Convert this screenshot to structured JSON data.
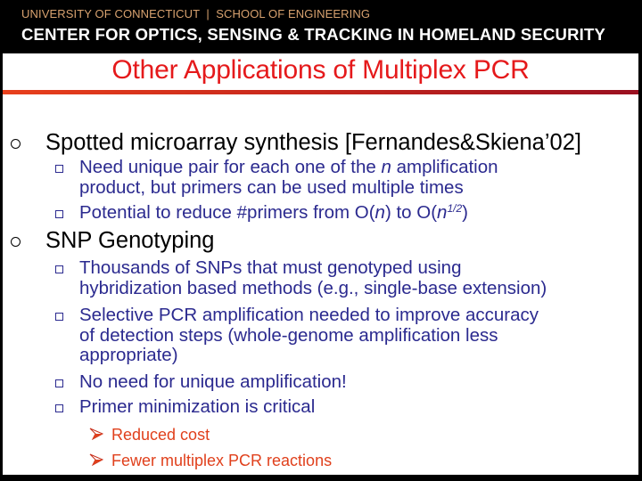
{
  "header": {
    "institution": "UNIVERSITY OF CONNECTICUT  |  SCHOOL OF ENGINEERING",
    "center": "CENTER FOR OPTICS, SENSING & TRACKING IN HOMELAND SECURITY"
  },
  "slide": {
    "title": "Other Applications of Multiplex PCR",
    "colors": {
      "title": "#e5191b",
      "level1_text": "#000000",
      "level2_text": "#2b2a8f",
      "level3_text": "#e0401c",
      "header_top": "#d8a26f"
    },
    "items": [
      {
        "text": "Spotted microarray synthesis [Fernandes&Skiena’02]",
        "bullet_icon": "hollow-circle-bullet",
        "subitems": [
          {
            "lines": [
              {
                "before": "Need unique pair for each one of the ",
                "italic": "n",
                "after": " amplification"
              },
              {
                "before": "product, but primers can be used multiple times"
              }
            ]
          },
          {
            "lines": [
              {
                "before": "Potential to reduce #primers from O(",
                "italic": "n",
                "after": ") to O(",
                "italic2": "n",
                "sup": "1/2",
                "after2": ")"
              }
            ]
          }
        ]
      },
      {
        "text": "SNP Genotyping",
        "bullet_icon": "hollow-circle-bullet",
        "subitems": [
          {
            "lines": [
              {
                "before": "Thousands of SNPs that must genotyped using"
              },
              {
                "before": "hybridization based methods (e.g., single-base extension)"
              }
            ]
          },
          {
            "lines": [
              {
                "before": "Selective PCR amplification needed to improve accuracy"
              },
              {
                "before": "of detection steps (whole-genome amplification less"
              },
              {
                "before": "appropriate)"
              }
            ]
          },
          {
            "lines": [
              {
                "before": "No need for unique amplification!"
              }
            ]
          },
          {
            "lines": [
              {
                "before": "Primer minimization is critical"
              }
            ],
            "subitems": [
              {
                "text": "Reduced cost",
                "bullet_icon": "arrowhead-bullet"
              },
              {
                "text": "Fewer multiplex PCR reactions",
                "bullet_icon": "arrowhead-bullet"
              }
            ]
          }
        ]
      }
    ]
  }
}
